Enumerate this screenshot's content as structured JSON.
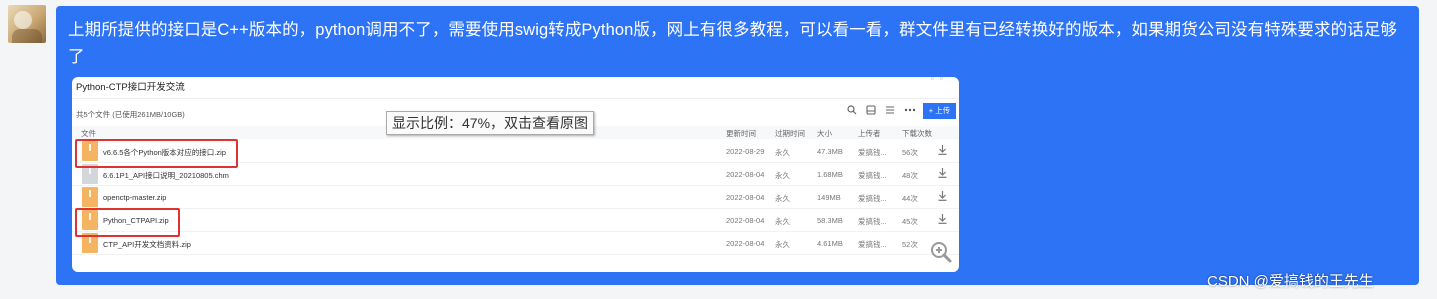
{
  "message": {
    "text": "上期所提供的接口是C++版本的，python调用不了，需要使用swig转成Python版，网上有很多教程，可以看一看，群文件里有已经转换好的版本，如果期货公司没有特殊要求的话足够了"
  },
  "screenshot": {
    "title": "Python-CTP接口开发交流",
    "file_count": "共5个文件 (已使用261MB/10GB)",
    "upload_label": "上传",
    "columns": {
      "name": "文件",
      "updated": "更新时间",
      "expire": "过期时间",
      "size": "大小",
      "uploader": "上传者",
      "downloads": "下载次数"
    },
    "files": [
      {
        "name": "v6.6.5各个Python版本对应的接口.zip",
        "updated": "2022-08-29",
        "expire": "永久",
        "size": "47.3MB",
        "uploader": "爱搞钱...",
        "downloads": "56次",
        "icon": "zip-file-icon"
      },
      {
        "name": "6.6.1P1_API接口说明_20210805.chm",
        "updated": "2022-08-04",
        "expire": "永久",
        "size": "1.68MB",
        "uploader": "爱搞钱...",
        "downloads": "48次",
        "icon": "chm-file-icon"
      },
      {
        "name": "openctp-master.zip",
        "updated": "2022-08-04",
        "expire": "永久",
        "size": "149MB",
        "uploader": "爱搞钱...",
        "downloads": "44次",
        "icon": "zip-file-icon"
      },
      {
        "name": "Python_CTPAPI.zip",
        "updated": "2022-08-04",
        "expire": "永久",
        "size": "58.3MB",
        "uploader": "爱搞钱...",
        "downloads": "45次",
        "icon": "zip-file-icon"
      },
      {
        "name": "CTP_API开发文档资料.zip",
        "updated": "2022-08-04",
        "expire": "永久",
        "size": "4.61MB",
        "uploader": "爱搞钱...",
        "downloads": "52次",
        "icon": "zip-file-icon"
      }
    ]
  },
  "tooltip": {
    "text": "显示比例：47%，双击查看原图"
  },
  "watermark": {
    "text": "CSDN @爱搞钱的王先生"
  },
  "colors": {
    "bubble": "#2d73f5",
    "highlight_box": "#e0322e",
    "file_zip": "#f5b461"
  }
}
